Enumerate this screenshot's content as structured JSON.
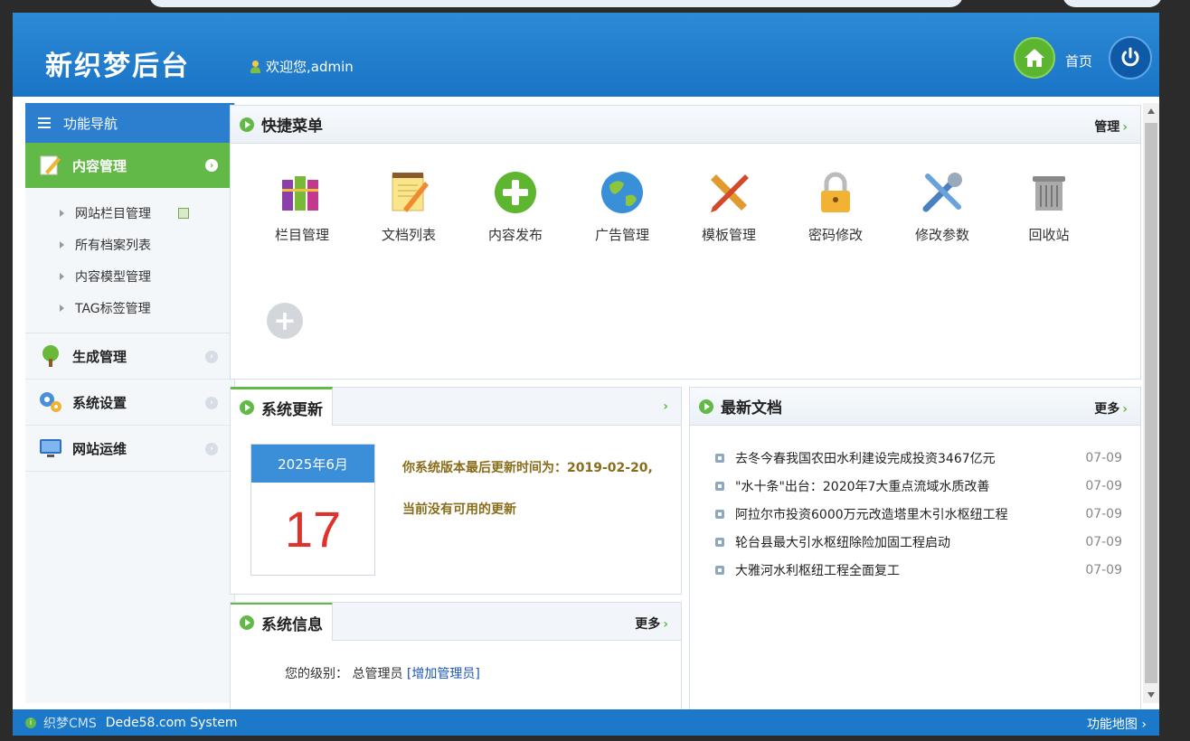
{
  "header": {
    "logo": "新织梦后台",
    "welcome": "欢迎您,admin",
    "home_label": "首页"
  },
  "sidebar": {
    "nav_title": "功能导航",
    "active": "内容管理",
    "sub_items": [
      {
        "label": "网站栏目管理"
      },
      {
        "label": "所有档案列表"
      },
      {
        "label": "内容模型管理"
      },
      {
        "label": "TAG标签管理"
      }
    ],
    "items": [
      {
        "label": "生成管理"
      },
      {
        "label": "系统设置"
      },
      {
        "label": "网站运维"
      }
    ]
  },
  "quick_menu": {
    "title": "快捷菜单",
    "manage": "管理",
    "items": [
      {
        "label": "栏目管理",
        "icon": "books-icon"
      },
      {
        "label": "文档列表",
        "icon": "notepad-icon"
      },
      {
        "label": "内容发布",
        "icon": "plus-circle-icon"
      },
      {
        "label": "广告管理",
        "icon": "globe-icon"
      },
      {
        "label": "模板管理",
        "icon": "ruler-pencil-icon"
      },
      {
        "label": "密码修改",
        "icon": "lock-icon"
      },
      {
        "label": "修改参数",
        "icon": "tools-icon"
      },
      {
        "label": "回收站",
        "icon": "trash-icon"
      }
    ]
  },
  "system_update": {
    "title": "系统更新",
    "more": "›",
    "calendar_month": "2025年6月",
    "calendar_day": "17",
    "line1": "你系统版本最后更新时间为：2019-02-20,",
    "line2": "当前没有可用的更新"
  },
  "latest_docs": {
    "title": "最新文档",
    "more": "更多",
    "items": [
      {
        "title": "去冬今春我国农田水利建设完成投资3467亿元",
        "date": "07-09"
      },
      {
        "title": "\"水十条\"出台：2020年7大重点流域水质改善",
        "date": "07-09"
      },
      {
        "title": "阿拉尔市投资6000万元改造塔里木引水枢纽工程",
        "date": "07-09"
      },
      {
        "title": "轮台县最大引水枢纽除险加固工程启动",
        "date": "07-09"
      },
      {
        "title": "大雅河水利枢纽工程全面复工",
        "date": "07-09"
      }
    ]
  },
  "system_info": {
    "title": "系统信息",
    "more": "更多",
    "level_label": "您的级别：",
    "level_value": "总管理员",
    "add_admin": "[增加管理员]"
  },
  "footer": {
    "brand": "织梦CMS",
    "system": "Dede58.com System",
    "map": "功能地图"
  },
  "colors": {
    "header_blue": "#1a74c6",
    "accent_green": "#62b947",
    "date_red": "#e0322b"
  }
}
